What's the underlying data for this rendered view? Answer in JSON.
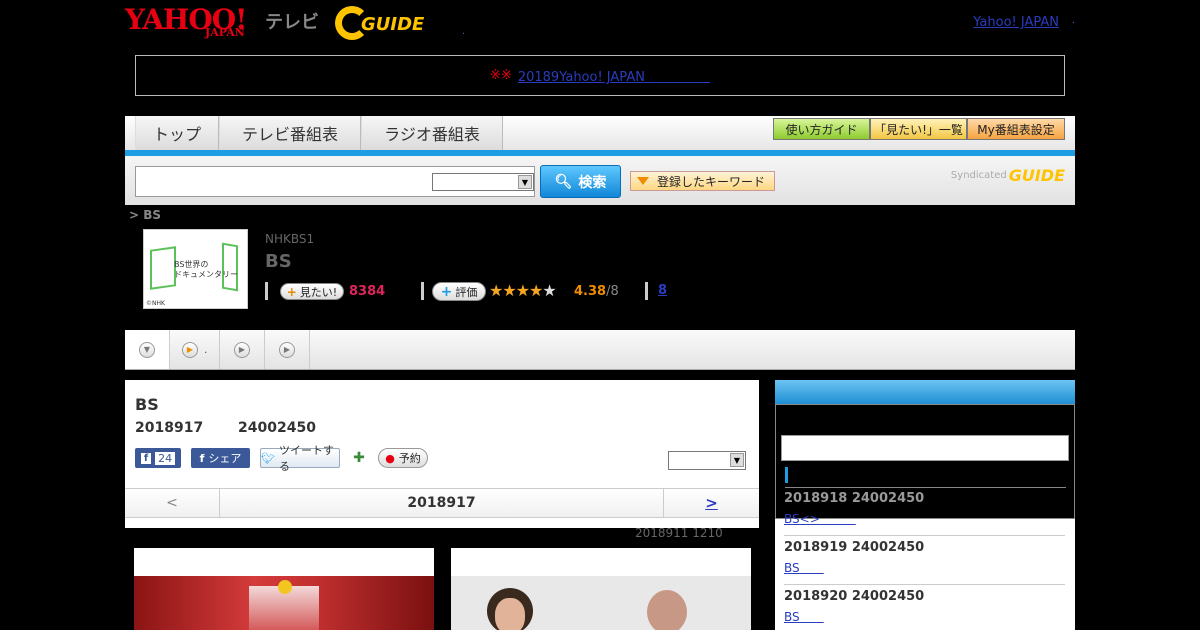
{
  "header": {
    "yahoo_logo": "YAHOO!",
    "yahoo_sub": "JAPAN",
    "tv_label": "テレビ",
    "gguide_logo": "GUIDE",
    "dot": ".",
    "yahoo_japan_link": "Yahoo! JAPAN",
    "trailing_dot": "."
  },
  "notice": {
    "marks": "※※",
    "link": "20189Yahoo! JAPAN　　　　　"
  },
  "nav": {
    "tabs": [
      "トップ",
      "テレビ番組表",
      "ラジオ番組表"
    ],
    "buttons": [
      "使い方ガイド",
      "「見たい!」一覧",
      "My番組表設定"
    ]
  },
  "search": {
    "button_label": "検索",
    "keyword_button": "登録したキーワード",
    "syndicated_label": "Syndicated",
    "syndicated_logo": "GUIDE"
  },
  "program": {
    "breadcrumb": "> BS",
    "thumb_text": "BS世界の\nドキュメンタリー",
    "thumb_credit": "©NHK",
    "channel": "NHKBS1",
    "title": "BS",
    "want_label": "見たい!",
    "want_count": "8384",
    "rate_label": "評価",
    "rating_value": "4.38",
    "rating_max": "/8",
    "review_count": "8"
  },
  "tabstrip": {
    "dot": "."
  },
  "main": {
    "title": "BS",
    "date": "2018917",
    "time": "24002450",
    "fb_count": "24",
    "share_label": "シェア",
    "tweet_label": "ツイートする",
    "reserve_label": "予約",
    "pager_prev": "<",
    "pager_current": "2018917",
    "pager_next": ">",
    "update_note": "2018911  1210"
  },
  "sidebar": {
    "items": [
      {
        "date": "2018918  24002450",
        "link": "BS<>　　　"
      },
      {
        "date": "2018919  24002450",
        "link": "BS　　"
      },
      {
        "date": "2018920  24002450",
        "link": "BS　　"
      }
    ]
  },
  "colors": {
    "yahoo_red": "#e60012",
    "gguide_yellow": "#ffc400",
    "nav_blue": "#1e9de3",
    "link_blue": "#2a3cbf",
    "want_pink": "#e0245e",
    "rating_orange": "#f08c00"
  }
}
